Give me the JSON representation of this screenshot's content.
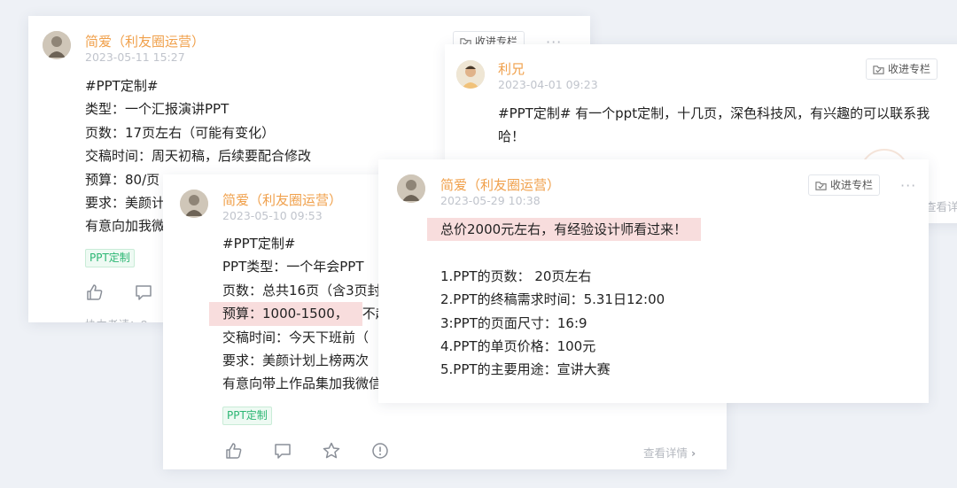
{
  "card1": {
    "author": "简爱（利友圈运营）",
    "time": "2023-05-11 15:27",
    "collect_label": "收进专栏",
    "more_label": "···",
    "lines": [
      "#PPT定制#",
      "类型：一个汇报演讲PPT",
      "页数：17页左右（可能有变化）",
      "交稿时间：周天初稿，后续要配合修改",
      "预算：80/页",
      "要求：美颜计划上榜两次",
      "有意向加我微信"
    ],
    "tag": "PPT定制",
    "footer_partial": "协力者请：8"
  },
  "card2": {
    "author": "利兄",
    "time": "2023-04-01 09:23",
    "collect_label": "收进专栏",
    "lines": [
      "#PPT定制# 有一个ppt定制，十几页，深色科技风，有兴趣的可以联系我",
      "哈！"
    ],
    "detail_partial": "查看详情"
  },
  "card3": {
    "author": "简爱（利友圈运营）",
    "time": "2023-05-10 09:53",
    "lines": [
      "#PPT定制#",
      "PPT类型：一个年会PPT",
      "页数：总共16页（含3页封面）",
      "交稿时间：今天下班前（",
      "要求：美颜计划上榜两次",
      "有意向带上作品集加我微信"
    ],
    "budget": "预算：1000-1500，",
    "budget_tail": "不超过",
    "tag": "PPT定制",
    "detail": "查看详情",
    "detail_chevron": "›"
  },
  "card4": {
    "author": "简爱（利友圈运营）",
    "time": "2023-05-29 10:38",
    "collect_label": "收进专栏",
    "more_label": "···",
    "headline": "总价2000元左右，有经验设计师看过来！",
    "items": [
      "1.PPT的页数： 20页左右",
      "2.PPT的终稿需求时间：5.31日12:00",
      "3:PPT的页面尺寸：16:9",
      "4.PPT的单页价格：100元",
      "5.PPT的主要用途：宣讲大赛"
    ]
  },
  "colors": {
    "author": "#f0a04b",
    "tag_text": "#2bb673",
    "highlight": "#f8dddd",
    "meta": "#c0c4cc"
  },
  "icons": [
    "like-icon",
    "comment-icon",
    "star-icon",
    "report-icon",
    "folder-icon"
  ]
}
